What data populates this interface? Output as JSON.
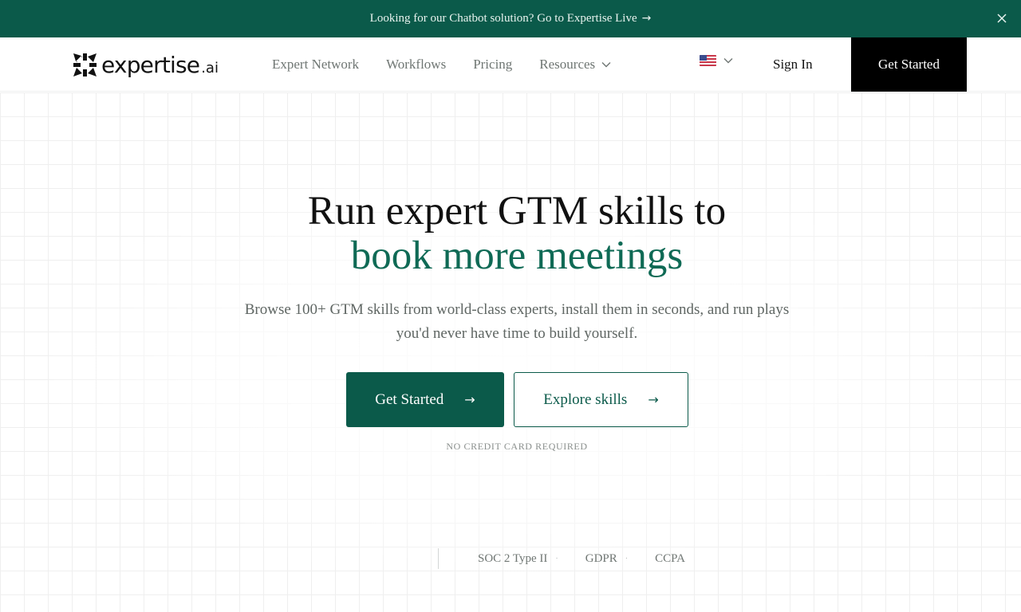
{
  "announcement": {
    "text": "Looking for our Chatbot solution? Go to Expertise Live",
    "arrow": "→",
    "close_icon": "close-icon"
  },
  "header": {
    "logo": {
      "text": "expertise",
      "suffix": ".ai"
    },
    "nav": [
      {
        "label": "Expert Network"
      },
      {
        "label": "Workflows"
      },
      {
        "label": "Pricing"
      },
      {
        "label": "Resources",
        "has_dropdown": true
      }
    ],
    "language": {
      "icon": "us-flag-icon"
    },
    "sign_in": "Sign In",
    "cta": "Get Started"
  },
  "hero": {
    "headline_line1": "Run expert GTM skills to",
    "headline_line2": "book more meetings",
    "subtitle": "Browse 100+ GTM skills from world-class experts, install them in seconds, and run plays you'd never have time to build yourself.",
    "primary_button": "Get Started",
    "secondary_button": "Explore skills",
    "button_arrow": "→",
    "note": "NO CREDIT CARD REQUIRED"
  },
  "compliance": {
    "items": [
      "SOC 2 Type II",
      "GDPR",
      "CCPA"
    ],
    "separator": "·"
  },
  "colors": {
    "brand_green": "#0b5a4a",
    "accent_text_green": "#0f6a55",
    "black": "#000000"
  }
}
